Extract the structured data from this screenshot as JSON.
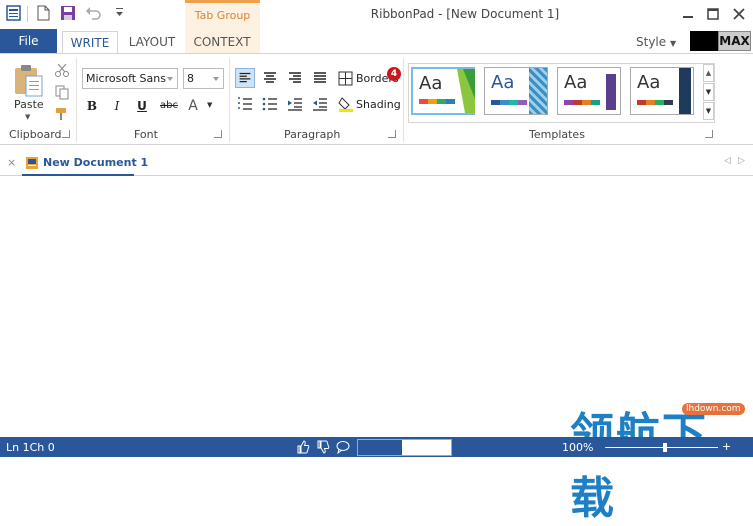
{
  "window": {
    "title": "RibbonPad - [New Document 1]"
  },
  "tab_group": {
    "label": "Tab Group"
  },
  "tabs": {
    "file": "File",
    "write": "WRITE",
    "layout": "LAYOUT",
    "context": "CONTEXT"
  },
  "style_menu": {
    "label": "Style",
    "max_label": "MAX"
  },
  "clipboard": {
    "paste_label": "Paste",
    "group_label": "Clipboard"
  },
  "font": {
    "family": "Microsoft Sans",
    "size": "8",
    "group_label": "Font",
    "bold": "B",
    "italic": "I",
    "underline": "U",
    "strike": "abc",
    "color": "A"
  },
  "paragraph": {
    "borders_label": "Borders",
    "borders_badge": "4",
    "shading_label": "Shading",
    "group_label": "Paragraph"
  },
  "templates": {
    "group_label": "Templates",
    "items": [
      "Aa",
      "Aa",
      "Aa",
      "Aa"
    ]
  },
  "document": {
    "tab_label": "New Document 1",
    "close": "×"
  },
  "status": {
    "position": "Ln 1Ch 0",
    "zoom": "100%",
    "progress_percent": 47
  },
  "colors": {
    "accent": "#2a579a",
    "tab_group": "#f0a04a",
    "badge": "#c8171e"
  },
  "watermark": {
    "chinese": "领航下载",
    "url": "lhdown.com"
  }
}
